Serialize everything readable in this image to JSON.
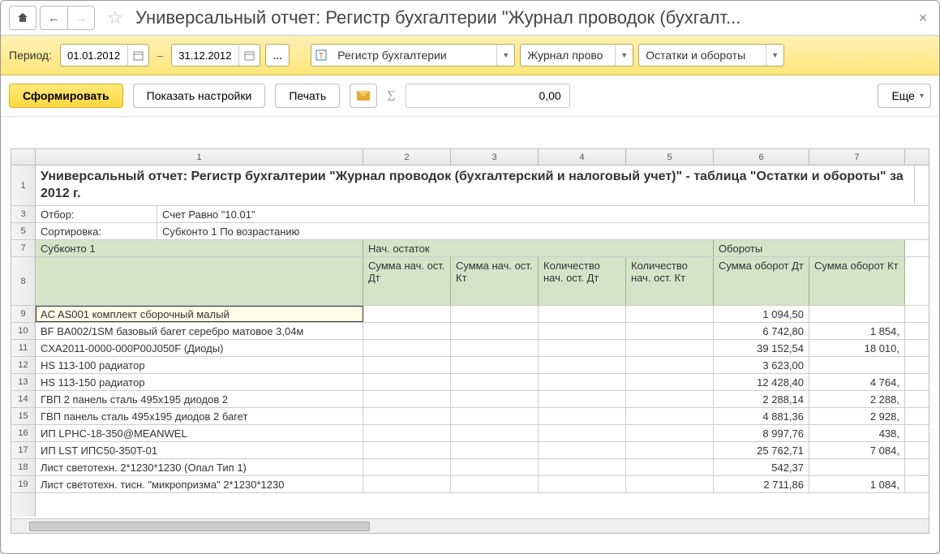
{
  "title": "Универсальный отчет: Регистр бухгалтерии \"Журнал проводок (бухгалт...",
  "period_label": "Период:",
  "date_from": "01.01.2012",
  "date_to": "31.12.2012",
  "sel_register": "Регистр бухгалтерии",
  "sel_journal": "Журнал прово",
  "sel_table": "Остатки и обороты",
  "btn_generate": "Сформировать",
  "btn_settings": "Показать настройки",
  "btn_print": "Печать",
  "num_value": "0,00",
  "btn_more": "Еще",
  "col_numbers": [
    "1",
    "2",
    "3",
    "4",
    "5",
    "6",
    "7"
  ],
  "row_numbers": [
    "1",
    "3",
    "5",
    "7",
    "8",
    "9",
    "10",
    "11",
    "12",
    "13",
    "14",
    "15",
    "16",
    "17",
    "18",
    "19"
  ],
  "report_title": "Универсальный отчет: Регистр бухгалтерии \"Журнал проводок (бухгалтерский и налоговый учет)\" - таблица \"Остатки и обороты\" за 2012 г.",
  "filter_label": "Отбор:",
  "filter_value": "Счет Равно \"10.01\"",
  "sort_label": "Сортировка:",
  "sort_value": "Субконто 1 По возрастанию",
  "hdr_subkonto": "Субконто 1",
  "hdr_nach": "Нач. остаток",
  "hdr_obor": "Обороты",
  "hdr_sum_nd": "Сумма нач. ост. Дт",
  "hdr_sum_nk": "Сумма нач. ост. Кт",
  "hdr_qty_nd": "Количество нач. ост. Дт",
  "hdr_qty_nk": "Количество нач. ост. Кт",
  "hdr_sum_od": "Сумма оборот Дт",
  "hdr_sum_ok": "Сумма оборот Кт",
  "rows": [
    {
      "name": "AC AS001 комплект сборочный малый",
      "od": "1 094,50",
      "ok": ""
    },
    {
      "name": "BF BA002/1SM базовый багет серебро матовое 3,04м",
      "od": "6 742,80",
      "ok": "1 854,"
    },
    {
      "name": "CXA2011-0000-000P00J050F (Диоды)",
      "od": "39 152,54",
      "ok": "18 010,"
    },
    {
      "name": "HS 113-100 радиатор",
      "od": "3 623,00",
      "ok": ""
    },
    {
      "name": "HS 113-150 радиатор",
      "od": "12 428,40",
      "ok": "4 764,"
    },
    {
      "name": "ГВП 2 панель сталь 495х195 диодов 2",
      "od": "2 288,14",
      "ok": "2 288,"
    },
    {
      "name": "ГВП панель сталь 495х195 диодов 2 багет",
      "od": "4 881,36",
      "ok": "2 928,"
    },
    {
      "name": "ИП LPHC-18-350@MEANWEL",
      "od": "8 997,76",
      "ok": "438,"
    },
    {
      "name": "ИП LST ИПС50-350T-01",
      "od": "25 762,71",
      "ok": "7 084,"
    },
    {
      "name": "Лист светотехн. 2*1230*1230 (Опал Тип 1)",
      "od": "542,37",
      "ok": ""
    },
    {
      "name": "Лист светотехн. тисн. \"микропризма\" 2*1230*1230",
      "od": "2 711,86",
      "ok": "1 084,"
    }
  ]
}
